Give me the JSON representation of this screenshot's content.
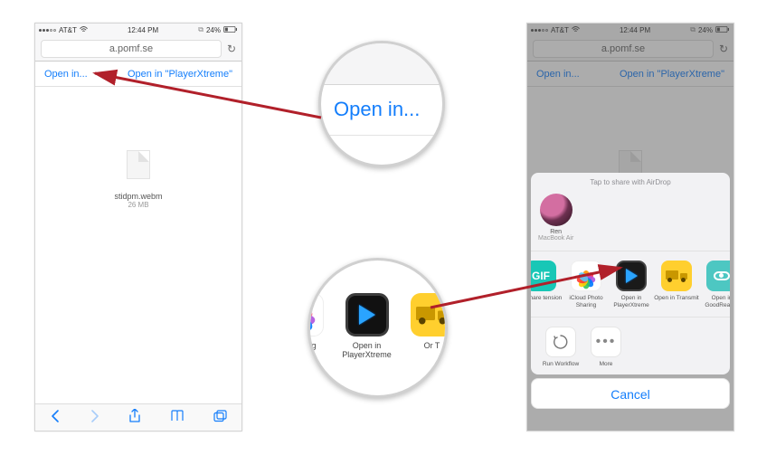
{
  "status": {
    "carrier": "AT&T",
    "time": "12:44 PM",
    "battery": "24%"
  },
  "addr": {
    "url": "a.pomf.se"
  },
  "actions": {
    "open_in": "Open in...",
    "open_player": "Open in \"PlayerXtreme\""
  },
  "file": {
    "name": "stidpm.webm",
    "size": "26 MB"
  },
  "zoom": {
    "open_in": "Open in..."
  },
  "share": {
    "airdrop_header": "Tap to share with AirDrop",
    "target_name": "Ren",
    "target_device": "MacBook Air",
    "apps": {
      "gif": "ly Share tension",
      "photos": "iCloud Photo Sharing",
      "playerx": "Open in PlayerXtreme",
      "transmit": "Open in Transmit",
      "goodreader": "Open in GoodReader"
    },
    "actions": {
      "workflow": "Run Workflow",
      "more": "More"
    },
    "cancel": "Cancel"
  },
  "lens_apps": {
    "photos": "hoto ing",
    "playerx": "Open in PlayerXtreme",
    "transmit": "Or T"
  }
}
